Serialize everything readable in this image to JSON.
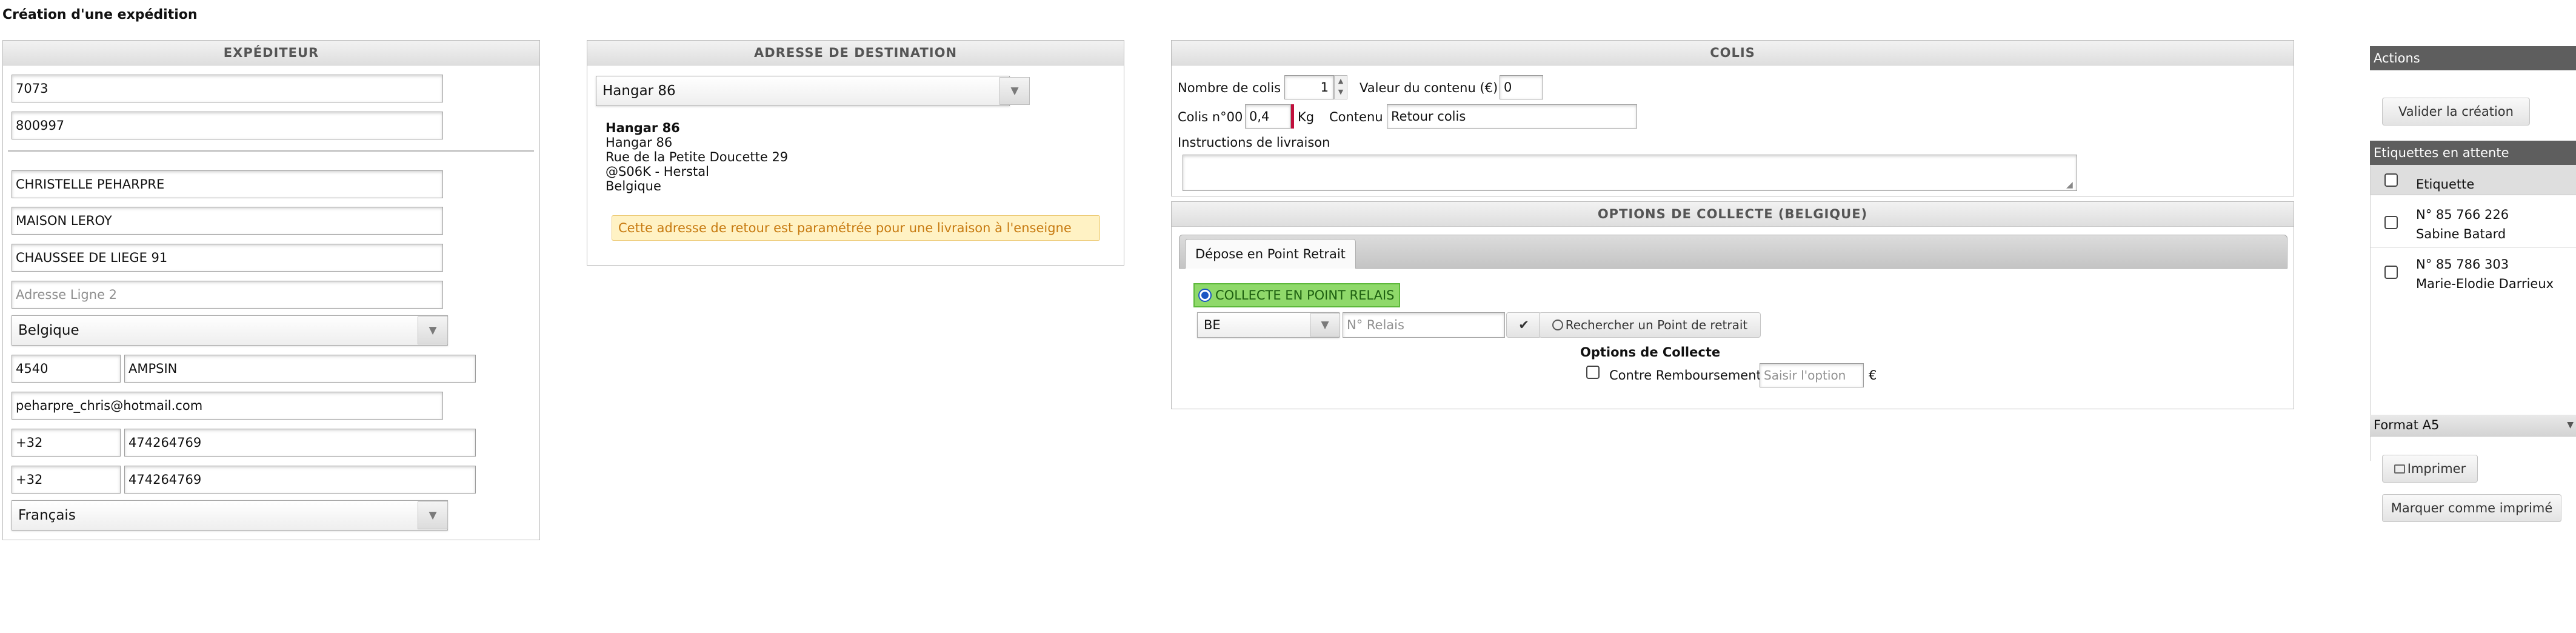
{
  "page_title": "Création d'une expédition",
  "expediteur": {
    "header": "EXPÉDITEUR",
    "field1": "7073",
    "field2": "800997",
    "name": "CHRISTELLE PEHARPRE",
    "company": "MAISON LEROY",
    "address1": "CHAUSSEE DE LIEGE 91",
    "address2_placeholder": "Adresse Ligne 2",
    "country": "Belgique",
    "postal_code": "4540",
    "city": "AMPSIN",
    "email": "peharpre_chris@hotmail.com",
    "phone1_prefix": "+32",
    "phone1_number": "474264769",
    "phone2_prefix": "+32",
    "phone2_number": "474264769",
    "language": "Français"
  },
  "destination": {
    "header": "ADRESSE DE DESTINATION",
    "selected": "Hangar 86",
    "address_title": "Hangar 86",
    "address_lines": [
      "Hangar 86",
      "Rue de la Petite Doucette 29",
      "@S06K - Herstal",
      "Belgique"
    ],
    "notice": "Cette adresse de retour est paramétrée pour une livraison à l'enseigne"
  },
  "colis": {
    "header": "COLIS",
    "nb_label": "Nombre de colis",
    "nb_value": "1",
    "valeur_label": "Valeur du contenu (€)",
    "valeur_value": "0",
    "colis_label": "Colis n°00",
    "poids_value": "0,4",
    "kg_label": "Kg",
    "contenu_label": "Contenu",
    "contenu_value": "Retour colis",
    "instructions_label": "Instructions de livraison",
    "instructions_value": ""
  },
  "options": {
    "header": "OPTIONS DE COLLECTE (BELGIQUE)",
    "tab_label": "Dépose en Point Retrait",
    "radio_label": "COLLECTE EN POINT RELAIS",
    "country": "BE",
    "relais_placeholder": "N° Relais",
    "check_glyph": "✔",
    "search_button": "Rechercher un Point de retrait",
    "search_icon": "search-icon",
    "options_title": "Options de Collecte",
    "remboursement_label": "Contre Remboursement",
    "option_placeholder": "Saisir l'option",
    "currency": "€"
  },
  "actions": {
    "header": "Actions",
    "validate_button": "Valider la création",
    "pending_header": "Etiquettes en attente",
    "column_label": "Etiquette",
    "labels": [
      {
        "number": "N° 85 766 226",
        "name": "Sabine Batard"
      },
      {
        "number": "N° 85 786 303",
        "name": "Marie-Elodie Darrieux"
      }
    ],
    "format_label": "Format A5",
    "print_button": "Imprimer",
    "print_icon": "printer-icon",
    "mark_button": "Marquer comme imprimé"
  },
  "colors": {
    "accent_green": "#8fd96a",
    "notice_bg": "#fff2c4",
    "notice_text": "#c77a10",
    "required_red": "#c0103c",
    "dark_bar": "#5e5e5e"
  }
}
